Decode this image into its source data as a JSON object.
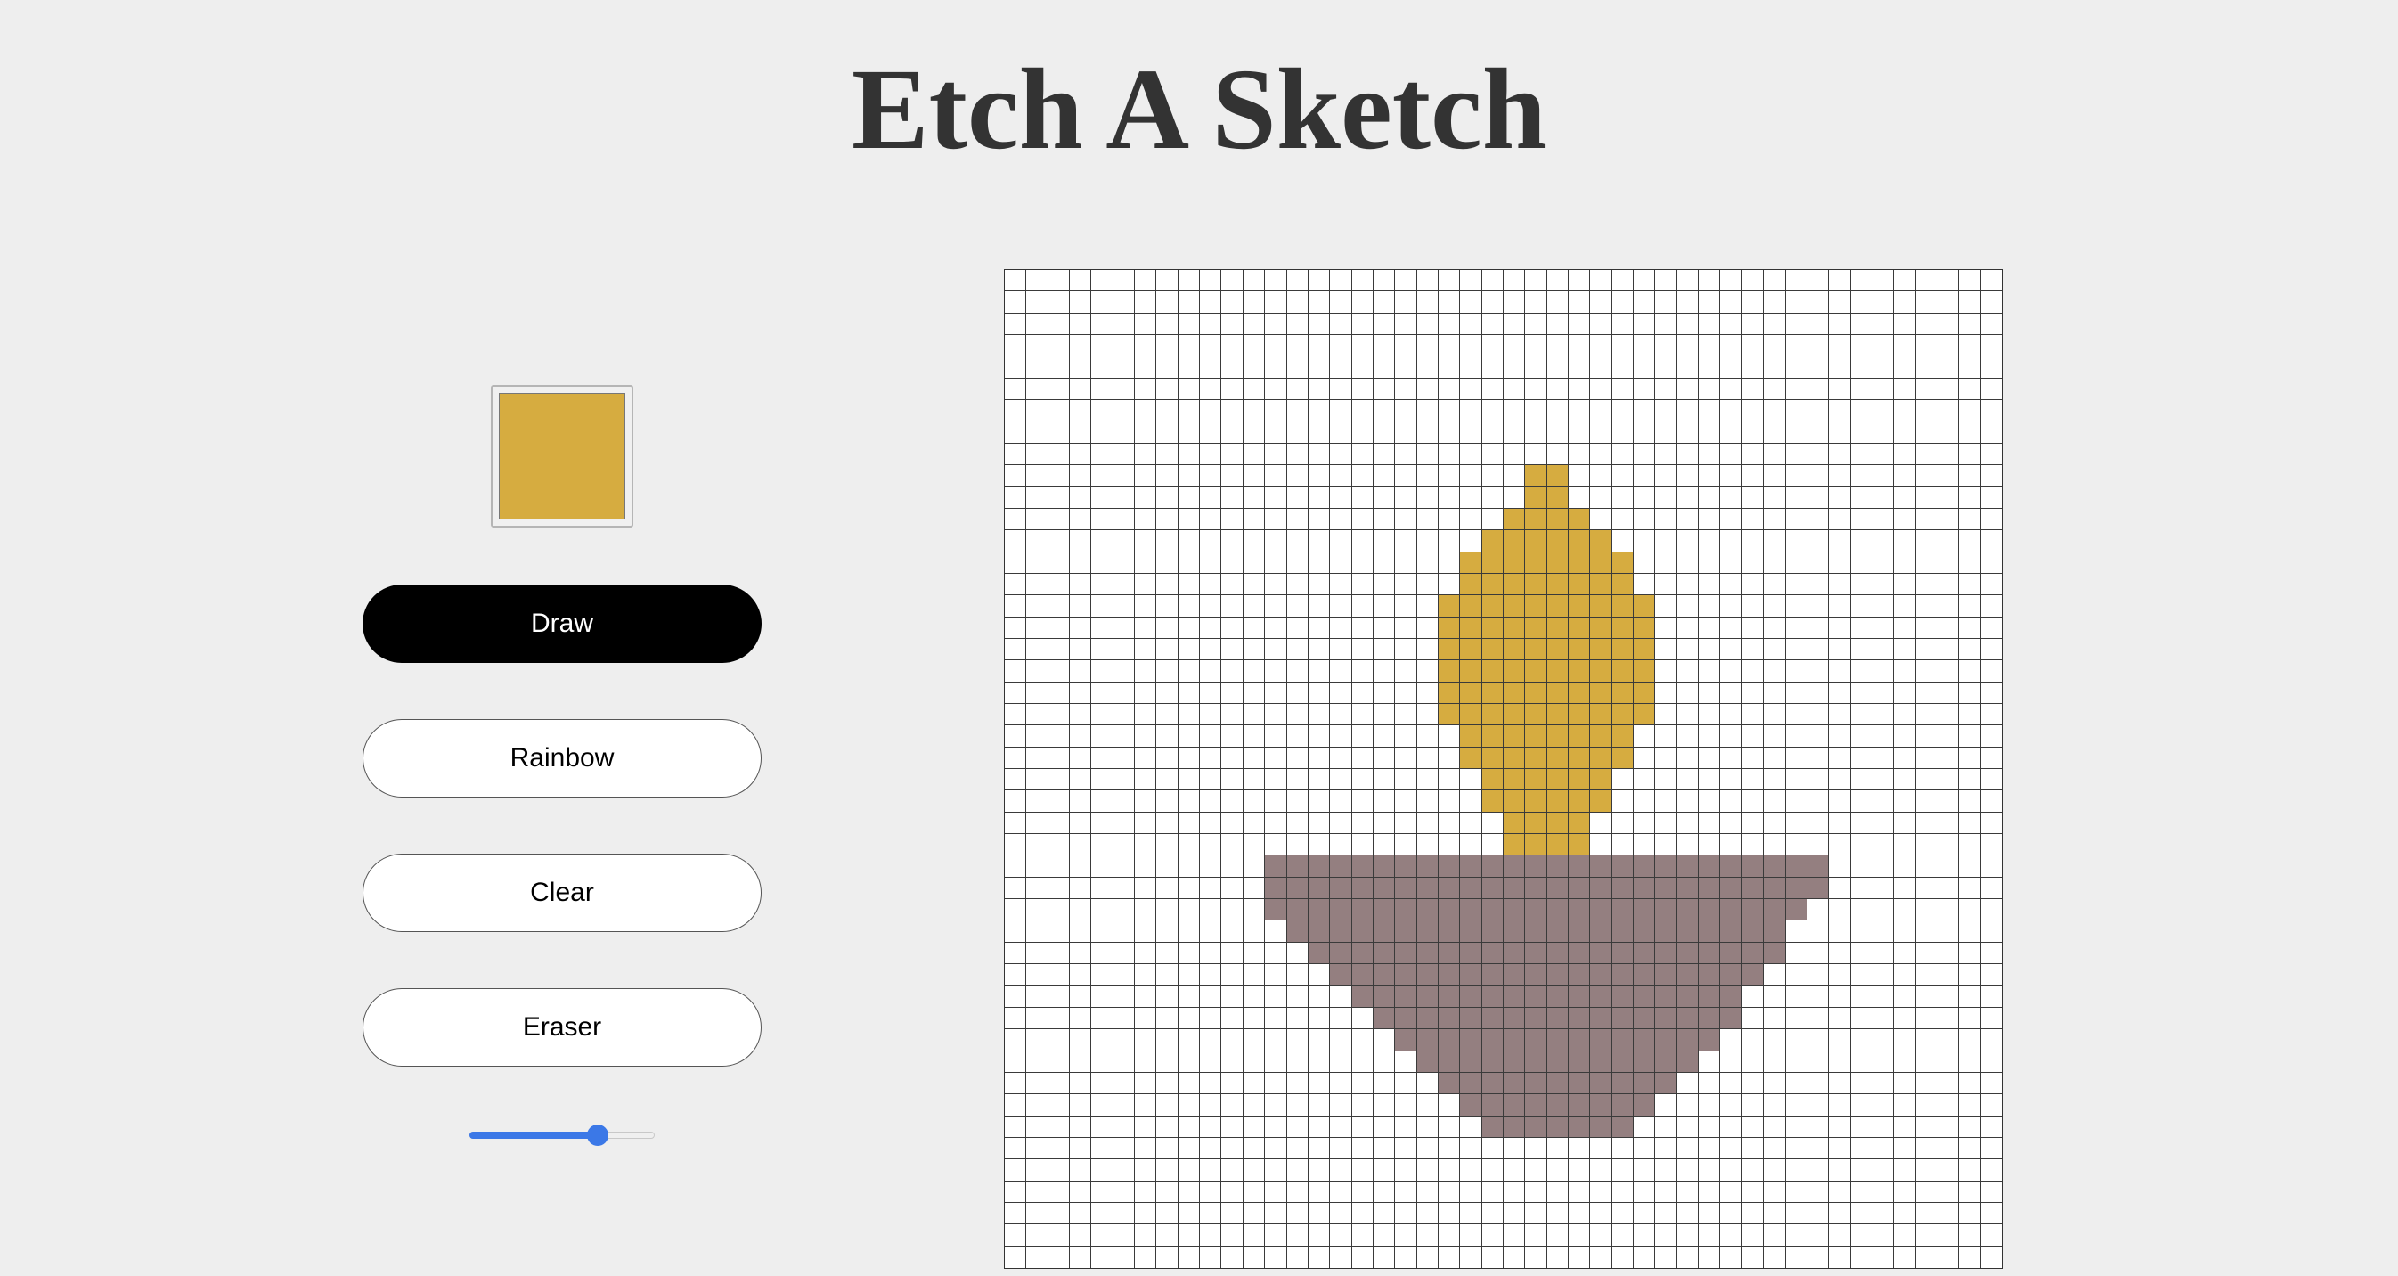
{
  "title": "Etch A Sketch",
  "color_picker": {
    "value": "#d6ac40"
  },
  "buttons": {
    "draw": "Draw",
    "rainbow": "Rainbow",
    "clear": "Clear",
    "eraser": "Eraser",
    "active": "draw"
  },
  "slider": {
    "fraction": 0.69
  },
  "colors": {
    "flame": "#d6ac40",
    "base": "#947f80",
    "empty": "#ffffff",
    "active_button": "#000000",
    "slider_accent": "#3b78e7"
  },
  "canvas": {
    "grid_size": 46,
    "flame_rows": [
      [
        9,
        24,
        25
      ],
      [
        10,
        24,
        25
      ],
      [
        11,
        23,
        26
      ],
      [
        12,
        22,
        27
      ],
      [
        13,
        21,
        28
      ],
      [
        14,
        21,
        28
      ],
      [
        15,
        20,
        29
      ],
      [
        16,
        20,
        29
      ],
      [
        17,
        20,
        29
      ],
      [
        18,
        20,
        29
      ],
      [
        19,
        20,
        29
      ],
      [
        20,
        20,
        29
      ],
      [
        21,
        21,
        28
      ],
      [
        22,
        21,
        28
      ],
      [
        23,
        22,
        27
      ],
      [
        24,
        22,
        27
      ],
      [
        25,
        23,
        26
      ],
      [
        26,
        23,
        26
      ]
    ],
    "base_rows": [
      [
        27,
        12,
        37
      ],
      [
        28,
        12,
        37
      ],
      [
        29,
        12,
        36
      ],
      [
        30,
        13,
        35
      ],
      [
        31,
        14,
        35
      ],
      [
        32,
        15,
        34
      ],
      [
        33,
        16,
        33
      ],
      [
        34,
        17,
        33
      ],
      [
        35,
        18,
        32
      ],
      [
        36,
        19,
        31
      ],
      [
        37,
        20,
        30
      ],
      [
        38,
        21,
        29
      ],
      [
        39,
        22,
        28
      ]
    ]
  }
}
